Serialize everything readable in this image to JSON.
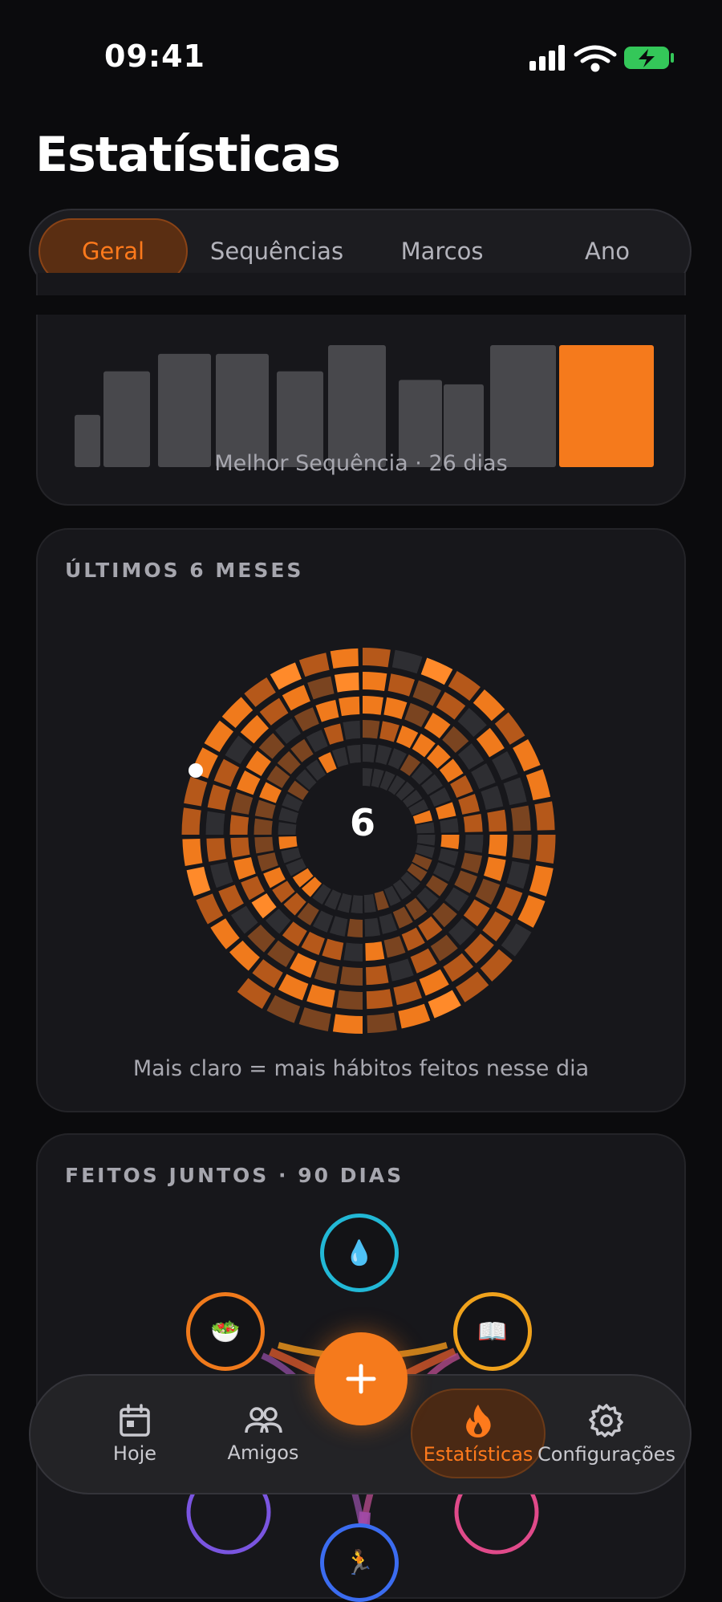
{
  "status_bar": {
    "time": "09:41"
  },
  "page": {
    "title": "Estatísticas"
  },
  "tabs": [
    {
      "label": "Geral",
      "active": true
    },
    {
      "label": "Sequências",
      "active": false
    },
    {
      "label": "Marcos",
      "active": false
    },
    {
      "label": "Ano",
      "active": false
    }
  ],
  "streak_card": {
    "caption": "Melhor Sequência · 26 dias",
    "chart_data": {
      "type": "bar",
      "values": [
        6,
        11,
        13,
        13,
        11,
        14,
        10,
        9.5,
        14,
        14
      ],
      "highlight_index": 9,
      "colors": {
        "bar": "#48484c",
        "highlight": "#f57a1c"
      }
    }
  },
  "months_card": {
    "label": "ÚLTIMOS 6 MESES",
    "center_value": "6",
    "caption": "Mais claro = mais hábitos feitos nesse dia",
    "colors": {
      "empty": "#2e2e32",
      "low": "#7a4420",
      "mid": "#b5581a",
      "high": "#f07a1c",
      "max": "#ff8a2a"
    }
  },
  "together_card": {
    "label": "FEITOS JUNTOS · 90 DIAS",
    "nodes": [
      {
        "icon": "water-drop-icon",
        "glyph": "💧",
        "color": "#22b8d6"
      },
      {
        "icon": "salad-icon",
        "glyph": "🥗",
        "color": "#f07a1c"
      },
      {
        "icon": "book-icon",
        "glyph": "📖",
        "color": "#f0a21c"
      },
      {
        "icon": "runner-icon",
        "glyph": "🏃",
        "color": "#3b6cf0"
      }
    ]
  },
  "nav": {
    "items": [
      {
        "label": "Hoje",
        "icon": "calendar-icon",
        "active": false
      },
      {
        "label": "Amigos",
        "icon": "people-icon",
        "active": false
      },
      {
        "label": "Estatísticas",
        "icon": "flame-icon",
        "active": true
      },
      {
        "label": "Configurações",
        "icon": "gear-icon",
        "active": false
      }
    ],
    "fab_icon": "plus-icon"
  }
}
